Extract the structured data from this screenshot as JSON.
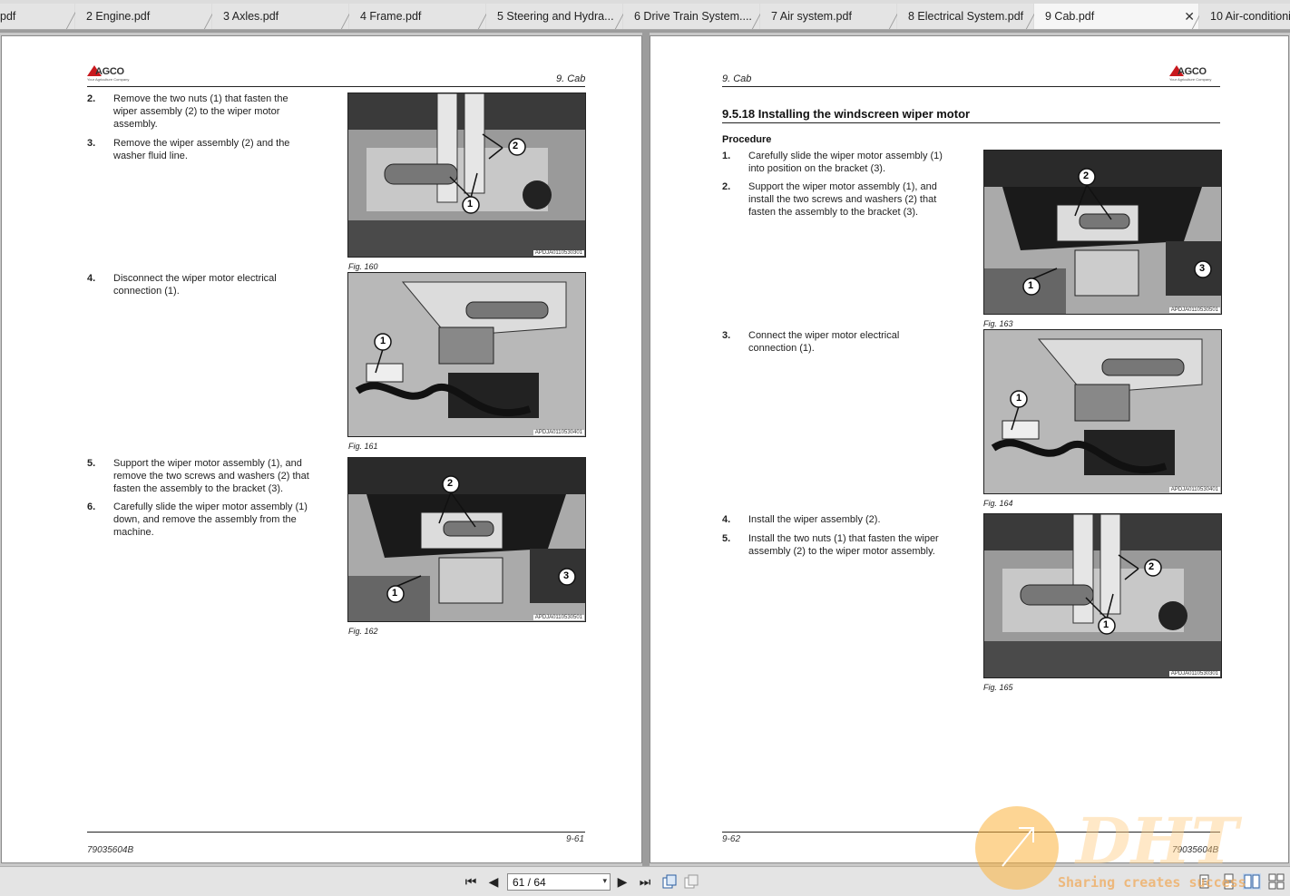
{
  "tabs": [
    {
      "label": "pdf",
      "active": false
    },
    {
      "label": "2 Engine.pdf",
      "active": false
    },
    {
      "label": "3 Axles.pdf",
      "active": false
    },
    {
      "label": "4 Frame.pdf",
      "active": false
    },
    {
      "label": "5 Steering and Hydra...",
      "active": false
    },
    {
      "label": "6 Drive Train System....",
      "active": false
    },
    {
      "label": "7 Air system.pdf",
      "active": false
    },
    {
      "label": "8 Electrical System.pdf",
      "active": false
    },
    {
      "label": "9 Cab.pdf",
      "active": true
    },
    {
      "label": "10 Air-conditioni",
      "active": false
    }
  ],
  "tab_close_glyph": "✕",
  "logo": {
    "word": "AGCO",
    "tagline": "Your Agriculture Company"
  },
  "left_page": {
    "header_title": "9. Cab",
    "steps": [
      {
        "num": "2.",
        "text": "Remove the two nuts (1) that fasten the\nwiper assembly (2) to the wiper motor\nassembly."
      },
      {
        "num": "3.",
        "text": "Remove the wiper assembly (2) and the\nwasher fluid line."
      },
      {
        "num": "4.",
        "text": "Disconnect the wiper motor electrical\nconnection (1)."
      },
      {
        "num": "5.",
        "text": "Support the wiper motor assembly (1), and\nremove the two screws and washers (2) that\nfasten the assembly to the bracket (3)."
      },
      {
        "num": "6.",
        "text": "Carefully slide the wiper motor assembly (1)\ndown, and remove the assembly from the\nmachine."
      }
    ],
    "figures": [
      {
        "caption": "Fig. 160",
        "code": "APDJA0110530301"
      },
      {
        "caption": "Fig. 161",
        "code": "APDJA0110530401"
      },
      {
        "caption": "Fig. 162",
        "code": "APDJA0110530501"
      }
    ],
    "footer_page": "9-61",
    "footer_doc": "79035604B"
  },
  "right_page": {
    "header_title": "9. Cab",
    "section_title": "9.5.18  Installing the windscreen wiper motor",
    "procedure_label": "Procedure",
    "steps": [
      {
        "num": "1.",
        "text": "Carefully slide the wiper motor assembly (1)\ninto position on the bracket (3)."
      },
      {
        "num": "2.",
        "text": "Support the wiper motor assembly (1), and\ninstall the two screws and washers (2) that\nfasten the assembly to the bracket (3)."
      },
      {
        "num": "3.",
        "text": "Connect the wiper motor electrical\nconnection (1)."
      },
      {
        "num": "4.",
        "text": "Install the wiper assembly (2)."
      },
      {
        "num": "5.",
        "text": "Install the two nuts (1) that fasten the wiper\nassembly (2) to the wiper motor assembly."
      }
    ],
    "figures": [
      {
        "caption": "Fig. 163",
        "code": "APDJA0110530501"
      },
      {
        "caption": "Fig. 164",
        "code": "APDJA0110530401"
      },
      {
        "caption": "Fig. 165",
        "code": "APDJA0110530301"
      }
    ],
    "footer_page": "9-62",
    "footer_doc": "79035604B"
  },
  "callouts": {
    "one": "1",
    "two": "2",
    "three": "3"
  },
  "toolbar": {
    "first_glyph": "⏮",
    "prev_glyph": "◀",
    "next_glyph": "▶",
    "last_glyph": "⏭",
    "page_value": "61 / 64",
    "caret": "▾"
  },
  "watermark": {
    "big": "DHT",
    "slogan": "Sharing creates success"
  },
  "colors": {
    "brand_red": "#c8191e",
    "watermark_orange": "#fcb23c"
  }
}
